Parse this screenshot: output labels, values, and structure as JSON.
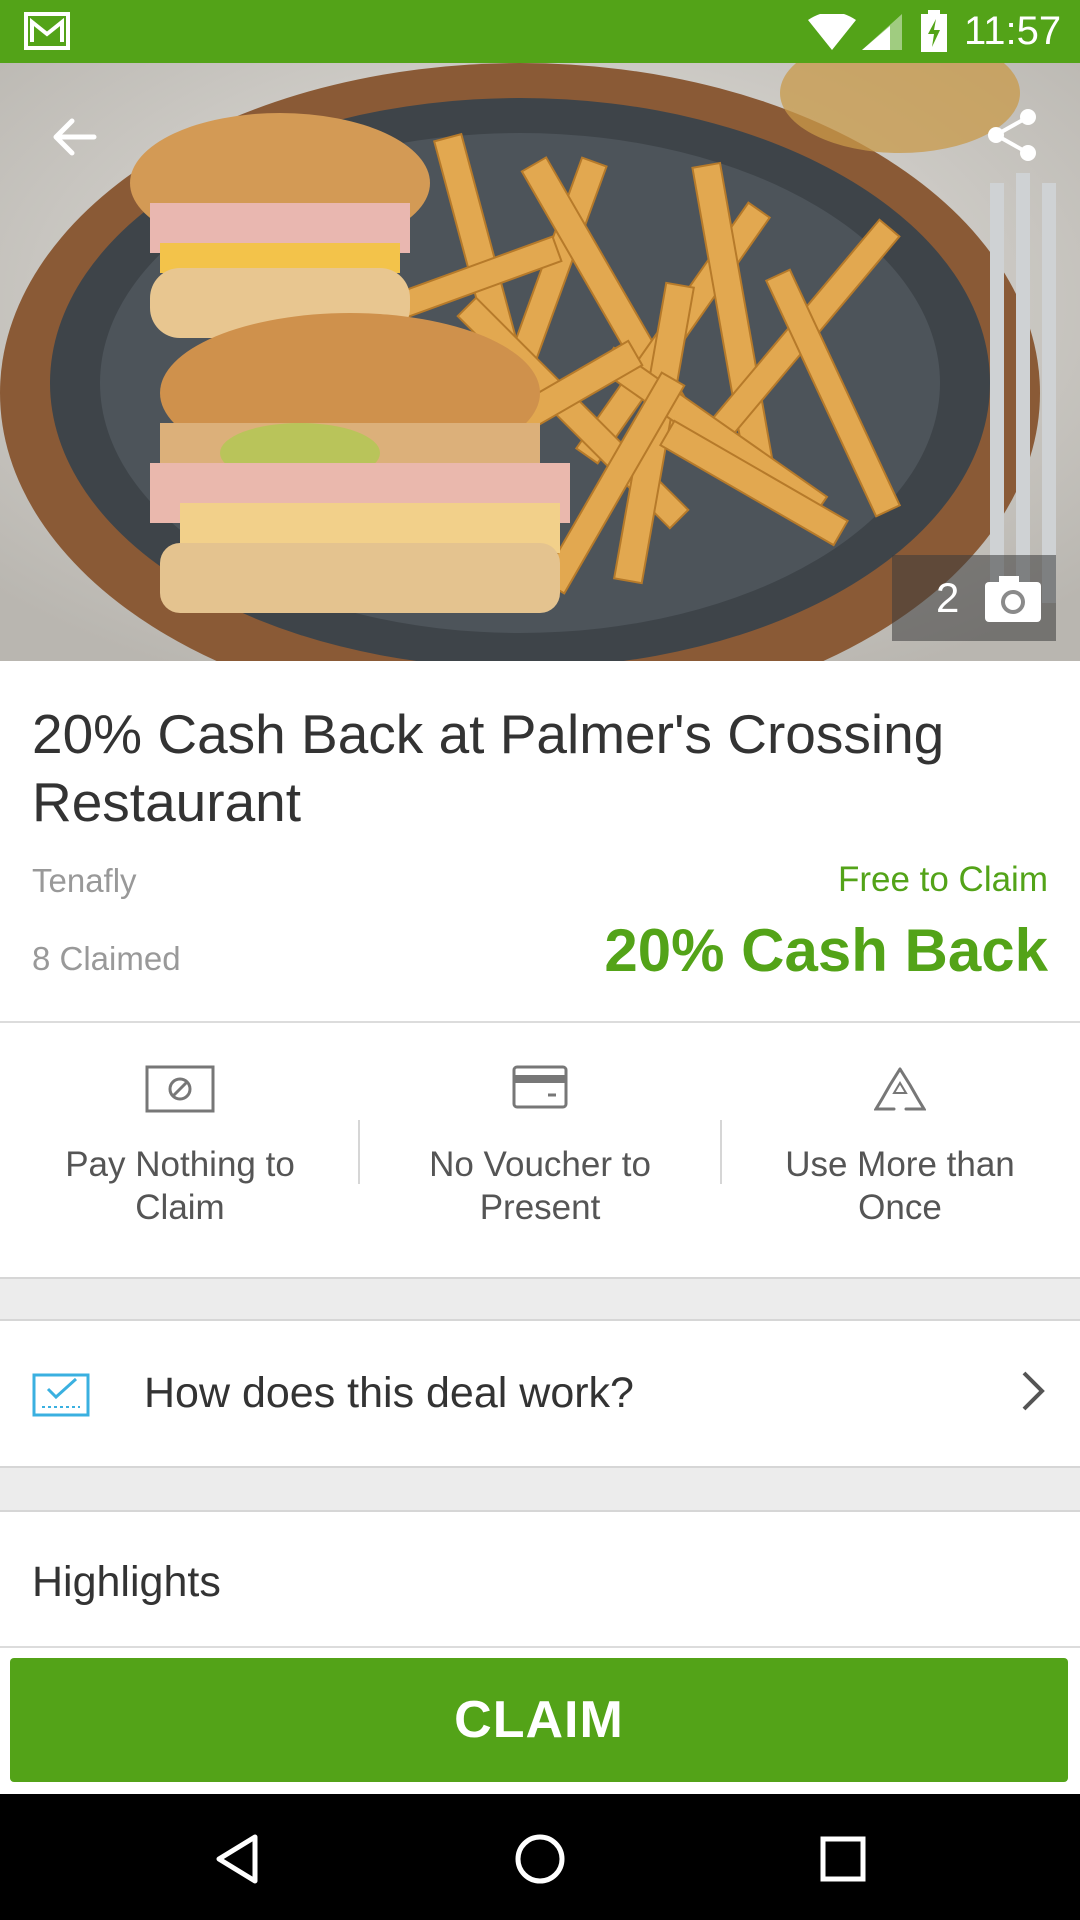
{
  "status_bar": {
    "time": "11:57",
    "icons": [
      "gmail-icon",
      "wifi-icon",
      "signal-icon",
      "battery-charging-icon"
    ]
  },
  "hero": {
    "photo_count": "2",
    "icons": [
      "back-arrow-icon",
      "share-icon",
      "camera-icon"
    ]
  },
  "deal": {
    "title": "20% Cash Back at Palmer's Crossing Restaurant",
    "location": "Tenafly",
    "claimed": "8 Claimed",
    "free_label": "Free to Claim",
    "cash_back": "20% Cash Back"
  },
  "features": [
    {
      "label": "Pay Nothing to Claim",
      "icon": "no-payment-icon"
    },
    {
      "label": "No Voucher to Present",
      "icon": "credit-card-icon"
    },
    {
      "label": "Use More than Once",
      "icon": "recycle-icon"
    }
  ],
  "how_it_works": {
    "label": "How does this deal work?",
    "icon": "checklist-icon"
  },
  "highlights": {
    "heading": "Highlights"
  },
  "claim": {
    "label": "CLAIM"
  },
  "colors": {
    "brand_green": "#53a318",
    "nav_black": "#000000"
  }
}
